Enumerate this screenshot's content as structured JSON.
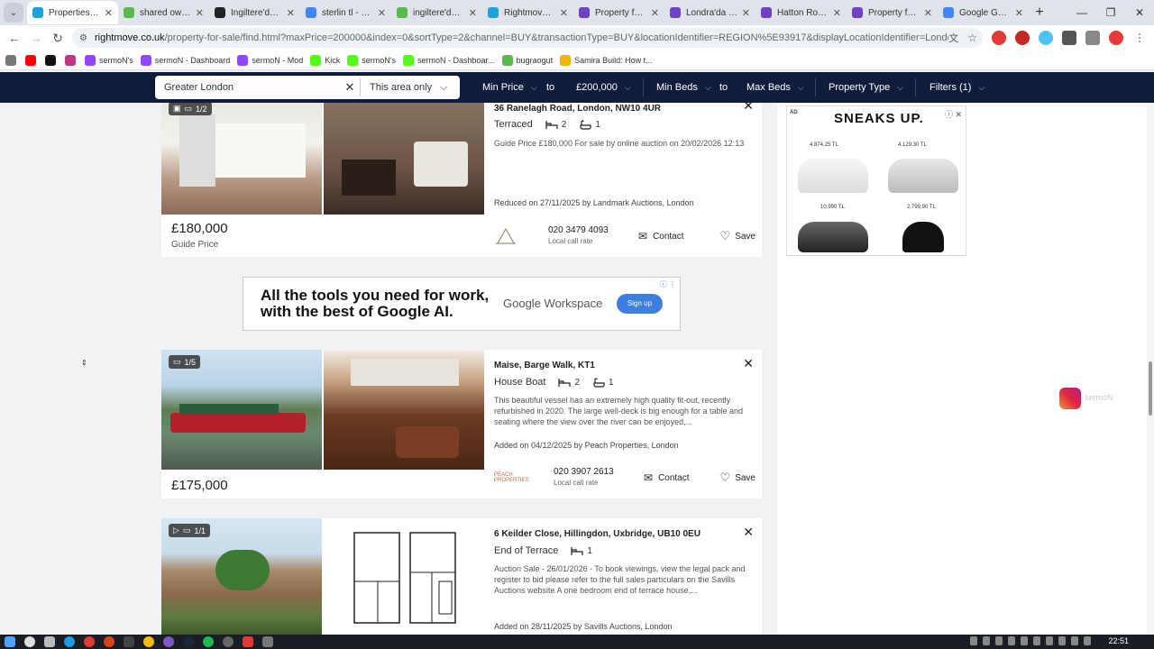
{
  "browser": {
    "tabs": [
      {
        "label": "Properties For",
        "active": true,
        "color": "#1fa2d9"
      },
      {
        "label": "shared owners",
        "active": false,
        "color": "#5bb84d"
      },
      {
        "label": "Ingiltere'de Ge",
        "active": false,
        "color": "#222222"
      },
      {
        "label": "sterlin tl - Goo",
        "active": false,
        "color": "#4285f4"
      },
      {
        "label": "ingiltere'de ev",
        "active": false,
        "color": "#5bb84d"
      },
      {
        "label": "Rightmove - U",
        "active": false,
        "color": "#1fa2d9"
      },
      {
        "label": "Property for sa",
        "active": false,
        "color": "#6f42c1"
      },
      {
        "label": "Londra'da satil",
        "active": false,
        "color": "#6f42c1"
      },
      {
        "label": "Hatton Road, F",
        "active": false,
        "color": "#6f42c1"
      },
      {
        "label": "Property for sa",
        "active": false,
        "color": "#6f42c1"
      },
      {
        "label": "Google Gemini",
        "active": false,
        "color": "#4285f4"
      }
    ],
    "url_host": "rightmove.co.uk",
    "url_rest": "/property-for-sale/find.html?maxPrice=200000&index=0&sortType=2&channel=BUY&transactionType=BUY&locationIdentifier=REGION%5E93917&displayLocationIdentifier=London.html&tenureTypes=FREEH..."
  },
  "bookmarks": [
    {
      "label": "sermoN's",
      "color": "#9146ff"
    },
    {
      "label": "sermoN - Dashboard",
      "color": "#9146ff"
    },
    {
      "label": "sermoN - Mod",
      "color": "#9146ff"
    },
    {
      "label": "Kick",
      "color": "#53fc18"
    },
    {
      "label": "sermoN's",
      "color": "#53fc18"
    },
    {
      "label": "sermoN - Dashboar...",
      "color": "#53fc18"
    },
    {
      "label": "bugraogut",
      "color": "#5bb84d"
    },
    {
      "label": "Samira Build: How t...",
      "color": "#f4b400"
    }
  ],
  "filters": {
    "search_value": "Greater London",
    "area": "This area only",
    "min_price": "Min Price",
    "to1": "to",
    "max_price": "£200,000",
    "min_beds": "Min Beds",
    "to2": "to",
    "max_beds": "Max Beds",
    "property_type": "Property Type",
    "filters": "Filters (1)"
  },
  "listings": [
    {
      "badge": "1/2",
      "address": "36 Ranelagh Road, London, NW10 4UR",
      "type": "Terraced",
      "beds": "2",
      "baths": "1",
      "description": "Guide Price £180,000 For sale by online auction on 20/02/2026 12:13",
      "added": "Reduced on 27/11/2025 by Landmark Auctions, London",
      "price": "£180,000",
      "price_note": "Guide Price",
      "phone": "020 3479 4093",
      "phone_note": "Local call rate",
      "contact": "Contact",
      "save": "Save"
    },
    {
      "badge": "1/5",
      "address": "Maise, Barge Walk, KT1",
      "type": "House Boat",
      "beds": "2",
      "baths": "1",
      "description": "This beautiful vessel has an extremely high quality fit-out, recently refurbished in 2020. The large well-deck is big enough for a table and seating where the view over the river can be enjoyed,...",
      "added": "Added on 04/12/2025 by Peach Properties, London",
      "price": "£175,000",
      "phone": "020 3907 2613",
      "phone_note": "Local call rate",
      "contact": "Contact",
      "save": "Save",
      "agent_logo": "PEACH PROPERTIES"
    },
    {
      "badge": "1/1",
      "address": "6 Keilder Close, Hillingdon, Uxbridge, UB10 0EU",
      "type": "End of Terrace",
      "beds": "1",
      "description": "Auction Sale - 26/01/2026 - To book viewings, view the legal pack and register to bid please refer to the full sales particulars on the Savills Auctions website A one bedroom end of terrace house,...",
      "added": "Added on 28/11/2025 by Savills Auctions, London"
    }
  ],
  "google_ad": {
    "line1": "All the tools you need for work,",
    "line2": "with the best of Google AI.",
    "brand": "Google Workspace",
    "cta": "Sign up"
  },
  "sneaks_ad": {
    "label": "AD",
    "brand": "SNEAKS UP.",
    "prices": [
      "4.874,25 TL",
      "4.129,30 TL",
      "10.990 TL",
      "2.799,90 TL"
    ]
  },
  "overlay": {
    "instagram_text": "sermoN"
  },
  "clock": "22:51"
}
